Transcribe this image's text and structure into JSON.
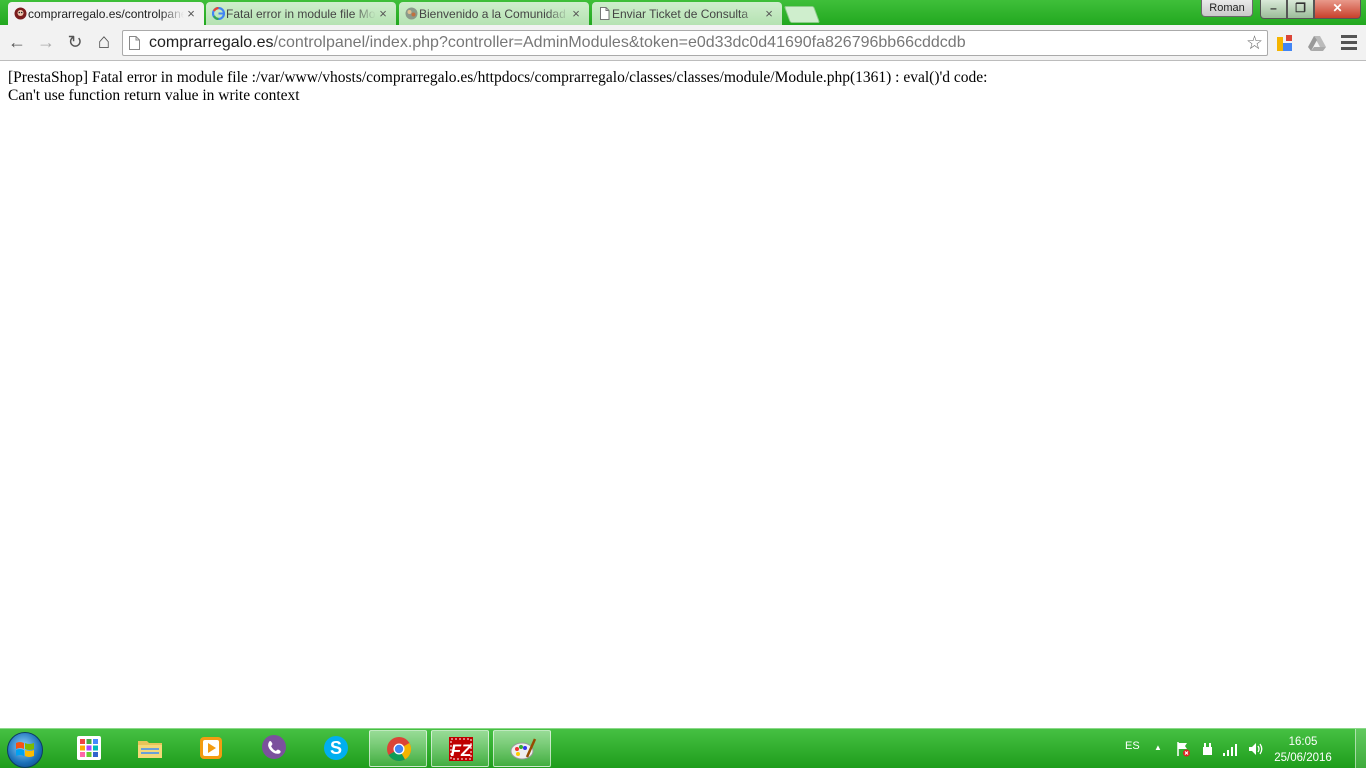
{
  "browser": {
    "tabs": [
      {
        "label": "comprarregalo.es/controlpanel/index.php",
        "close": "×",
        "active": true
      },
      {
        "label": "Fatal error in module file Module.php",
        "close": "×",
        "active": false
      },
      {
        "label": "Bienvenido a la Comunidad",
        "close": "×",
        "active": false
      },
      {
        "label": "Enviar Ticket de Consulta",
        "close": "×",
        "active": false
      }
    ],
    "user_button": "Roman",
    "window_controls": {
      "minimize": "–",
      "maximize": "❐",
      "close": "✕"
    },
    "toolbar": {
      "back": "←",
      "forward": "→",
      "reload": "↻",
      "home": "⌂"
    },
    "address": {
      "host": "comprarregalo.es",
      "path": "/controlpanel/index.php?controller=AdminModules&token=e0d33dc0d41690fa826796bb66cddcdb"
    },
    "star": "☆"
  },
  "page": {
    "error_line_1": "[PrestaShop] Fatal error in module file :/var/www/vhosts/comprarregalo.es/httpdocs/comprarregalo/classes/classes/module/Module.php(1361) : eval()'d code:",
    "error_line_2": "Can't use function return value in write context"
  },
  "taskbar": {
    "pinned": [
      {
        "name": "apps-grid-icon"
      },
      {
        "name": "file-explorer-icon"
      },
      {
        "name": "media-player-icon"
      },
      {
        "name": "viber-icon"
      },
      {
        "name": "skype-icon"
      },
      {
        "name": "chrome-icon"
      },
      {
        "name": "filezilla-icon"
      },
      {
        "name": "paint-icon"
      }
    ],
    "language": "ES",
    "tray_chevron": "▲",
    "clock_time": "16:05",
    "clock_date": "25/06/2016"
  },
  "colors": {
    "title_green": "#22a81f",
    "taskbar_green": "#2db02a",
    "skype_blue": "#00aff0",
    "viber_purple": "#7b519d",
    "filezilla_red": "#bf0000"
  }
}
